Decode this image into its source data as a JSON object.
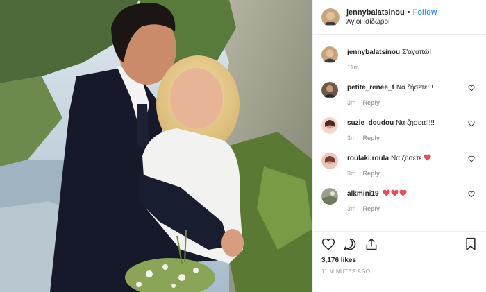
{
  "post": {
    "username": "jennybalatsinou",
    "follow_label": "Follow",
    "separator": "•",
    "location": "Άγιοι Ισίδωροι"
  },
  "caption": {
    "username": "jennybalatsinou",
    "text": "Σ'αγαπώ!",
    "time": "11m"
  },
  "comments": [
    {
      "username": "petite_renee_f",
      "text": "Να ζήσετε!!!",
      "time": "3m",
      "reply_label": "Reply",
      "hearts": 0
    },
    {
      "username": "suzie_doudou",
      "text": "Να ζήσετε!!!!",
      "time": "3m",
      "reply_label": "Reply",
      "hearts": 0
    },
    {
      "username": "roulaki.roula",
      "text": "Να ζήσετε",
      "time": "3m",
      "reply_label": "Reply",
      "hearts": 1
    },
    {
      "username": "alkmini19",
      "text": "",
      "time": "3m",
      "reply_label": "Reply",
      "hearts": 3
    }
  ],
  "footer": {
    "likes": "3,176 likes",
    "time_ago": "11 MINUTES AGO"
  },
  "colors": {
    "link": "#3897f0",
    "heart_red": "#ed4956",
    "muted": "#999999",
    "text": "#262626"
  },
  "icons": [
    "heart-outline-icon",
    "comment-icon",
    "share-icon",
    "bookmark-icon",
    "heart-filled-icon"
  ]
}
